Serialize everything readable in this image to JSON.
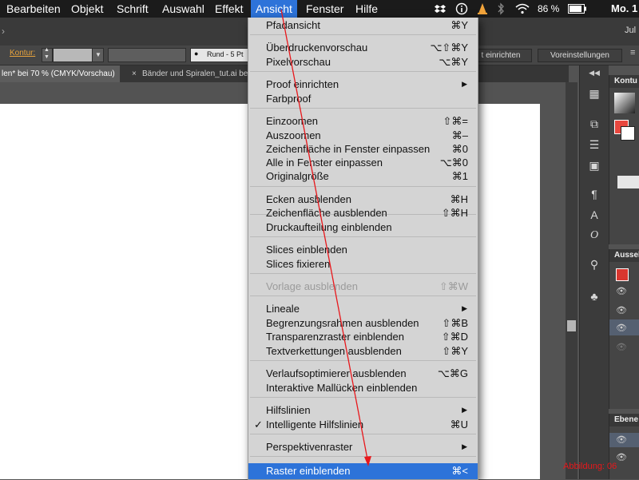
{
  "menubar": {
    "items": [
      "Bearbeiten",
      "Objekt",
      "Schrift",
      "Auswahl",
      "Effekt",
      "Ansicht",
      "Fenster",
      "Hilfe"
    ],
    "battery": "86 %",
    "clock": "Mo. 1"
  },
  "titlebar": {
    "right_text": "Jul"
  },
  "controlbar": {
    "stroke_label": "Kontur:",
    "brush_value": "Rund - 5 Pt",
    "btn_setup": "t einrichten",
    "btn_prefs": "Voreinstellungen"
  },
  "tabs": [
    {
      "label": "len* bei 70 % (CMYK/Vorschau)",
      "close": "×",
      "active": true
    },
    {
      "label": "Bänder und Spiralen_tut.ai be",
      "close": "×",
      "active": false
    }
  ],
  "panels": {
    "top": "Kontu",
    "middle": "Aussel",
    "bottom": "Ebene"
  },
  "menu": {
    "items": [
      {
        "label": "Pfadansicht",
        "shortcut": "⌘Y"
      },
      {
        "label": "Überdruckenvorschau",
        "shortcut": "⌥⇧⌘Y"
      },
      {
        "label": "Pixelvorschau",
        "shortcut": "⌥⌘Y"
      },
      {
        "label": "Proof einrichten",
        "submenu": true
      },
      {
        "label": "Farbproof"
      },
      {
        "label": "Einzoomen",
        "shortcut": "⇧⌘="
      },
      {
        "label": "Auszoomen",
        "shortcut": "⌘–"
      },
      {
        "label": "Zeichenfläche in Fenster einpassen",
        "shortcut": "⌘0"
      },
      {
        "label": "Alle in Fenster einpassen",
        "shortcut": "⌥⌘0"
      },
      {
        "label": "Originalgröße",
        "shortcut": "⌘1"
      },
      {
        "label": "Ecken ausblenden",
        "shortcut": "⌘H"
      },
      {
        "label": "Zeichenfläche ausblenden",
        "shortcut": "⇧⌘H"
      },
      {
        "label": "Druckaufteilung einblenden"
      },
      {
        "label": "Slices einblenden"
      },
      {
        "label": "Slices fixieren"
      },
      {
        "label": "Vorlage ausblenden",
        "shortcut": "⇧⌘W",
        "disabled": true
      },
      {
        "label": "Lineale",
        "submenu": true
      },
      {
        "label": "Begrenzungsrahmen ausblenden",
        "shortcut": "⇧⌘B"
      },
      {
        "label": "Transparenzraster einblenden",
        "shortcut": "⇧⌘D"
      },
      {
        "label": "Textverkettungen ausblenden",
        "shortcut": "⇧⌘Y"
      },
      {
        "label": "Verlaufsoptimierer ausblenden",
        "shortcut": "⌥⌘G"
      },
      {
        "label": "Interaktive Mallücken einblenden"
      },
      {
        "label": "Hilfslinien",
        "submenu": true
      },
      {
        "label": "Intelligente Hilfslinien",
        "shortcut": "⌘U",
        "checked": true
      },
      {
        "label": "Perspektivenraster",
        "submenu": true
      },
      {
        "label": "Raster einblenden",
        "shortcut": "⌘<",
        "highlighted": true
      }
    ],
    "submenu_glyph": "▶",
    "check_glyph": "✓"
  },
  "caption": "Abbildung: 06",
  "colors": {
    "menubar": "#1b1b1b",
    "highlight": "#2d73d9",
    "menu_bg": "#d4d4d4",
    "annotation": "#e8171b",
    "stroke_label": "#e8a33c"
  },
  "icons": [
    "dropbox-icon",
    "info-icon",
    "vlc-icon",
    "bluetooth-icon",
    "wifi-icon",
    "battery-icon"
  ]
}
